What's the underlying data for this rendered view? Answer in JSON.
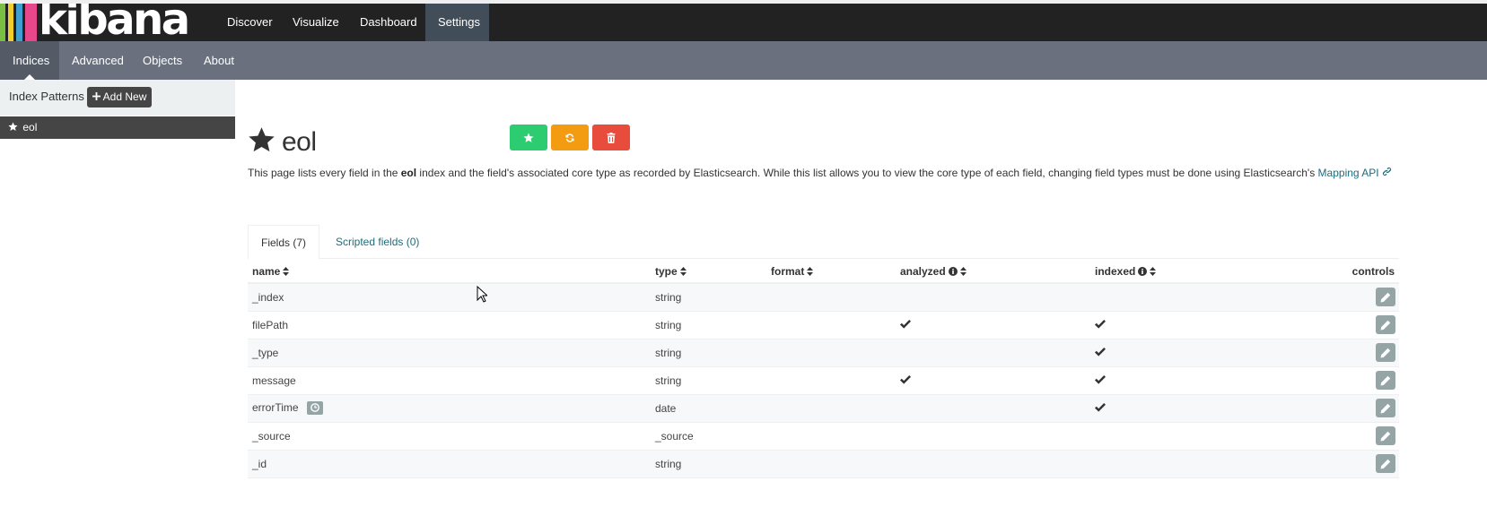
{
  "app": {
    "logo_text": "kibana",
    "logo_colors": [
      "#e8478b",
      "#3f9fd2",
      "#f2ce2b",
      "#79bf43",
      "#1a1a1a"
    ]
  },
  "navbar": {
    "tabs": [
      {
        "label": "Discover"
      },
      {
        "label": "Visualize"
      },
      {
        "label": "Dashboard"
      },
      {
        "label": "Settings",
        "active": true
      }
    ]
  },
  "subnav": {
    "tabs": [
      {
        "label": "Indices",
        "active": true
      },
      {
        "label": "Advanced"
      },
      {
        "label": "Objects"
      },
      {
        "label": "About"
      }
    ]
  },
  "sidebar": {
    "title": "Index Patterns",
    "add_new_label": "Add New",
    "add_icon": "plus-icon",
    "items": [
      {
        "label": "eol",
        "icon": "star-icon",
        "default": true
      }
    ]
  },
  "index": {
    "title": "eol",
    "title_icon": "star-icon",
    "buttons": [
      {
        "icon": "star-icon",
        "color": "#2ecc71"
      },
      {
        "icon": "refresh-icon",
        "color": "#f39c12"
      },
      {
        "icon": "trash-icon",
        "color": "#e74c3c"
      }
    ],
    "description": {
      "part1": "This page lists every field in the ",
      "index_name": "eol",
      "part2": " index and the field's associated core type as recorded by Elasticsearch. While this list allows you to view the core type of each field, changing field types must be done using Elasticsearch's ",
      "link_label": "Mapping API",
      "link_icon": "link-icon"
    }
  },
  "tabs": [
    {
      "label": "Fields (7)",
      "active": true
    },
    {
      "label": "Scripted fields (0)"
    }
  ],
  "table": {
    "headers": {
      "name": "name",
      "type": "type",
      "format": "format",
      "analyzed": "analyzed",
      "indexed": "indexed",
      "controls": "controls"
    },
    "rows": [
      {
        "name": "_index",
        "type": "string",
        "analyzed": false,
        "indexed": false
      },
      {
        "name": "filePath",
        "type": "string",
        "analyzed": true,
        "indexed": true
      },
      {
        "name": "_type",
        "type": "string",
        "analyzed": false,
        "indexed": true
      },
      {
        "name": "message",
        "type": "string",
        "analyzed": true,
        "indexed": true
      },
      {
        "name": "errorTime",
        "type": "date",
        "analyzed": false,
        "indexed": true,
        "badge": "clock-icon"
      },
      {
        "name": "_source",
        "type": "_source",
        "analyzed": false,
        "indexed": false
      },
      {
        "name": "_id",
        "type": "string",
        "analyzed": false,
        "indexed": false
      }
    ]
  }
}
